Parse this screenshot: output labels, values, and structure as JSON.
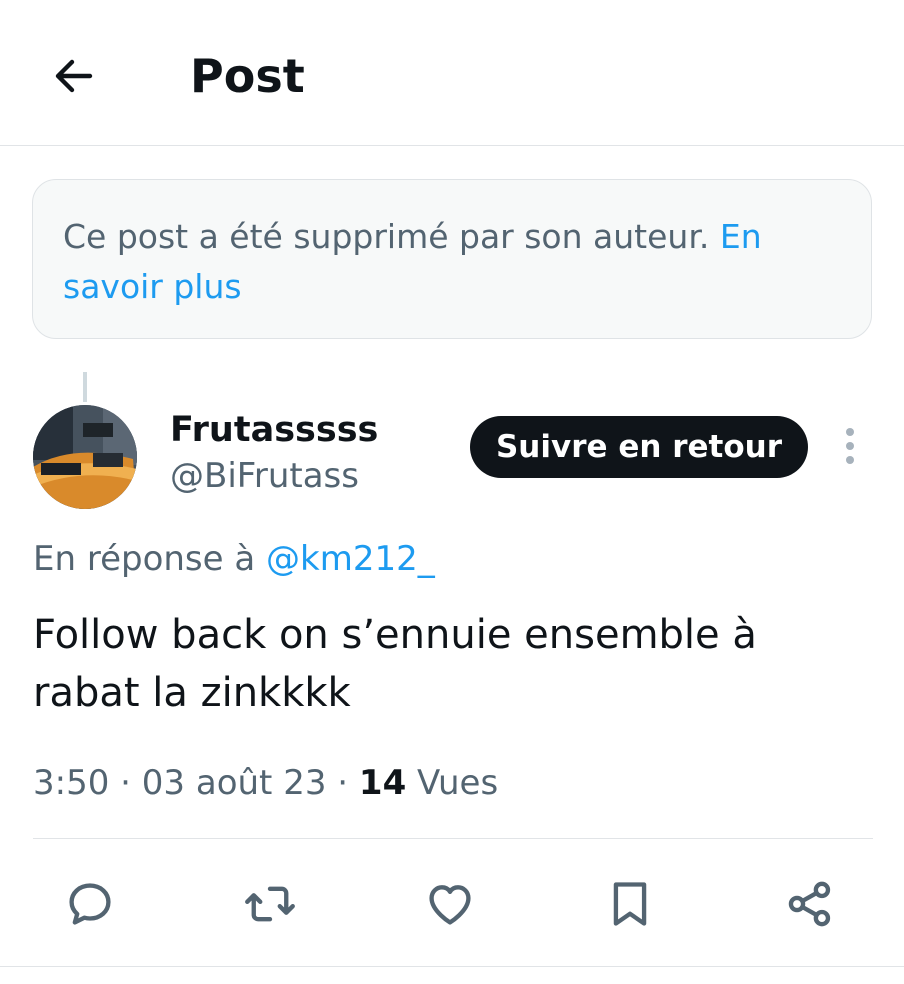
{
  "header": {
    "title": "Post",
    "back_icon": "arrow-left-icon"
  },
  "notice": {
    "text": "Ce post a été supprimé par son auteur. ",
    "link": "En savoir plus"
  },
  "post": {
    "author": {
      "display_name": "Frutasssss",
      "handle": "@BiFrutass"
    },
    "follow_label": "Suivre en retour",
    "reply_prefix": "En réponse à ",
    "reply_handle": "@km212_",
    "text": "Follow back on s’ennuie ensemble à rabat la zinkkkk",
    "time": "3:50",
    "sep1": " · ",
    "date": "03 août 23",
    "sep2": " · ",
    "views_count": "14",
    "views_label": " Vues"
  },
  "actions": [
    {
      "name": "reply",
      "icon": "reply-icon"
    },
    {
      "name": "repost",
      "icon": "repost-icon"
    },
    {
      "name": "like",
      "icon": "heart-icon"
    },
    {
      "name": "bookmark",
      "icon": "bookmark-icon"
    },
    {
      "name": "share",
      "icon": "share-icon"
    }
  ],
  "colors": {
    "accent": "#1d9bf0",
    "text": "#0f1419",
    "secondary": "#536471",
    "icon": "#536471"
  }
}
